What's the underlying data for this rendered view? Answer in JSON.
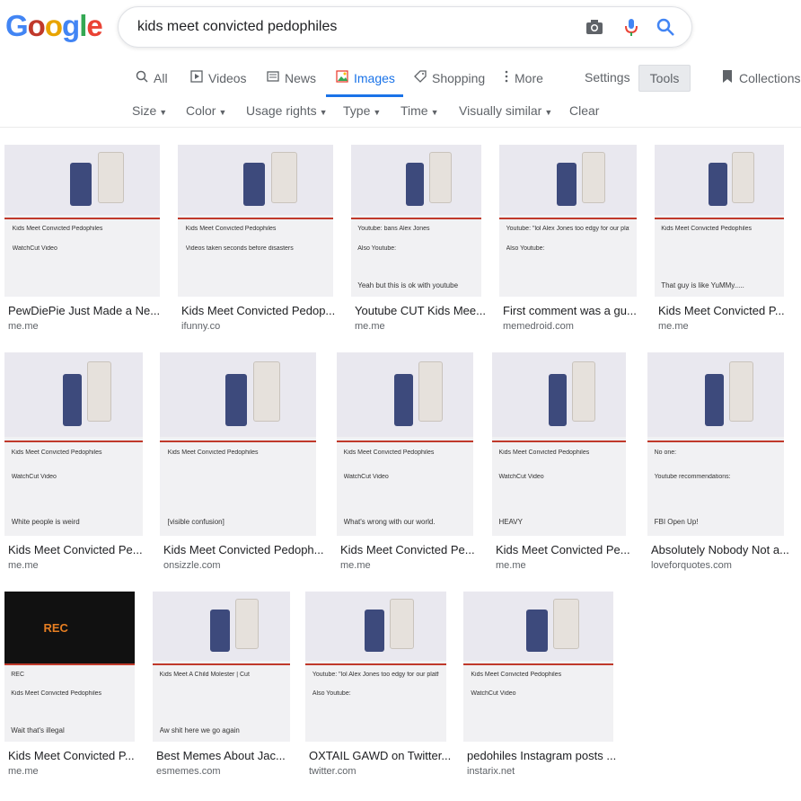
{
  "logo_text": "Google",
  "search": {
    "query": "kids meet convicted pedophiles"
  },
  "tabs": [
    {
      "label": "All",
      "icon": "search-icon"
    },
    {
      "label": "Videos",
      "icon": "video-icon"
    },
    {
      "label": "News",
      "icon": "news-icon"
    },
    {
      "label": "Images",
      "icon": "image-icon",
      "active": true
    },
    {
      "label": "Shopping",
      "icon": "tag-icon"
    },
    {
      "label": "More",
      "icon": "more-vert-icon"
    }
  ],
  "settings_label": "Settings",
  "tools_label": "Tools",
  "collections_label": "Collections",
  "filters": [
    {
      "label": "Size"
    },
    {
      "label": "Color"
    },
    {
      "label": "Usage rights"
    },
    {
      "label": "Type"
    },
    {
      "label": "Time"
    },
    {
      "label": "Visually similar"
    },
    {
      "label": "Clear"
    }
  ],
  "results": [
    {
      "title": "PewDiePie Just Made a Ne...",
      "source": "me.me",
      "cap": "Kids Meet Convicted Pedophiles",
      "extra": "WatchCut Video",
      "bottom": ""
    },
    {
      "title": "Kids Meet Convicted Pedop...",
      "source": "ifunny.co",
      "cap": "Kids Meet Convicted Pedophiles",
      "extra": "Videos taken seconds before disasters",
      "bottom": ""
    },
    {
      "title": "Youtube CUT Kids Mee...",
      "source": "me.me",
      "cap": "Youtube: bans Alex Jones",
      "extra": "Also Youtube:",
      "bottom": "Yeah but this is ok with youtube"
    },
    {
      "title": "First comment was a gu...",
      "source": "memedroid.com",
      "cap": "Youtube: \"lol Alex Jones too edgy for our platform bro\"",
      "extra": "Also Youtube:",
      "bottom": ""
    },
    {
      "title": "Kids Meet Convicted P...",
      "source": "me.me",
      "cap": "Kids Meet Convicted Pedophiles",
      "extra": "",
      "bottom": "That guy is like YuMMy....."
    },
    {
      "title": "Kids Meet Convicted Pe...",
      "source": "me.me",
      "cap": "Kids Meet Convicted Pedophiles",
      "extra": "WatchCut Video",
      "bottom": "White people is weird"
    },
    {
      "title": "Kids Meet Convicted Pedoph...",
      "source": "onsizzle.com",
      "cap": "Kids Meet Convicted Pedophiles",
      "extra": "",
      "bottom": "[visible confusion]"
    },
    {
      "title": "Kids Meet Convicted Pe...",
      "source": "me.me",
      "cap": "Kids Meet Convicted Pedophiles",
      "extra": "WatchCut Video",
      "bottom": "What's wrong with our world."
    },
    {
      "title": "Kids Meet Convicted Pe...",
      "source": "me.me",
      "cap": "Kids Meet Convicted Pedophiles",
      "extra": "WatchCut Video",
      "bottom": "HEAVY"
    },
    {
      "title": "Absolutely Nobody Not a...",
      "source": "loveforquotes.com",
      "cap": "No one:",
      "extra": "Youtube recommendations:",
      "bottom": "FBI Open Up!"
    },
    {
      "title": "Kids Meet Convicted P...",
      "source": "me.me",
      "cap": "REC",
      "extra": "Kids Meet Convicted Pedophiles",
      "bottom": "Wait that's illegal"
    },
    {
      "title": "Best Memes About Jac...",
      "source": "esmemes.com",
      "cap": "Kids Meet A Child Molester | Cut",
      "extra": "",
      "bottom": "Aw shit here we go again"
    },
    {
      "title": "OXTAIL GAWD on Twitter...",
      "source": "twitter.com",
      "cap": "Youtube: \"lol Alex Jones too edgy for our platform bro\"",
      "extra": "Also Youtube:",
      "bottom": ""
    },
    {
      "title": "pedohiles Instagram posts ...",
      "source": "instarix.net",
      "cap": "Kids Meet Convicted Pedophiles",
      "extra": "WatchCut Video",
      "bottom": ""
    }
  ]
}
